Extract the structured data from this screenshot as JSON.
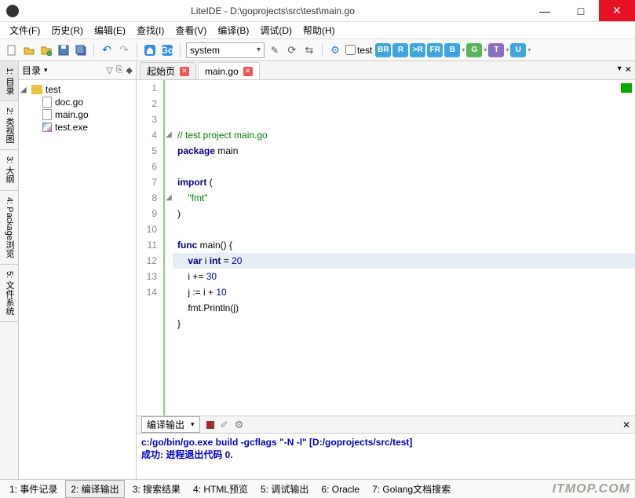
{
  "window": {
    "title": "LiteIDE - D:\\goprojects\\src\\test\\main.go",
    "minimize": "—",
    "maximize": "□",
    "close": "✕"
  },
  "menu": {
    "file": "文件(F)",
    "history": "历史(R)",
    "edit": "编辑(E)",
    "find": "查找(I)",
    "view": "查看(V)",
    "build": "编译(B)",
    "debug": "调试(D)",
    "help": "帮助(H)"
  },
  "toolbar": {
    "env": "system",
    "test_label": "test",
    "badges": [
      "BR",
      "R",
      ">R",
      "FR",
      "B",
      "G",
      "T",
      "U"
    ],
    "badge_colors": [
      "#3da5e0",
      "#3da5e0",
      "#3da5e0",
      "#3da5e0",
      "#3da5e0",
      "#57b557",
      "#8a70c0",
      "#3da5e0"
    ]
  },
  "leftrail": [
    "1: 目录",
    "2: 类视图",
    "3: 大纲",
    "4: Package浏览",
    "5: 文件系统"
  ],
  "sidebar": {
    "title": "目录",
    "root": "test",
    "files": [
      {
        "name": "doc.go",
        "icon": "file"
      },
      {
        "name": "main.go",
        "icon": "file"
      },
      {
        "name": "test.exe",
        "icon": "exe"
      }
    ]
  },
  "tabs": {
    "start": "起始页",
    "file": "main.go"
  },
  "code": {
    "lines": [
      {
        "n": 1,
        "fold": "",
        "html": "<span class='cm'>// test project main.go</span>"
      },
      {
        "n": 2,
        "fold": "",
        "html": "<span class='kw'>package</span> main"
      },
      {
        "n": 3,
        "fold": "",
        "html": ""
      },
      {
        "n": 4,
        "fold": "◢",
        "html": "<span class='kw'>import</span> ("
      },
      {
        "n": 5,
        "fold": "",
        "html": "    <span class='str'>\"fmt\"</span>"
      },
      {
        "n": 6,
        "fold": "",
        "html": ")"
      },
      {
        "n": 7,
        "fold": "",
        "html": ""
      },
      {
        "n": 8,
        "fold": "◢",
        "html": "<span class='kw'>func</span> main() {"
      },
      {
        "n": 9,
        "fold": "",
        "hl": true,
        "html": "    <span class='kw'>var</span> i <span class='kw'>int</span> = <span class='num'>20</span>"
      },
      {
        "n": 10,
        "fold": "",
        "html": "    i += <span class='num'>30</span>"
      },
      {
        "n": 11,
        "fold": "",
        "html": "    j := i + <span class='num'>10</span>"
      },
      {
        "n": 12,
        "fold": "",
        "html": "    fmt.Println(j)"
      },
      {
        "n": 13,
        "fold": "",
        "html": "}"
      },
      {
        "n": 14,
        "fold": "",
        "html": ""
      }
    ]
  },
  "output": {
    "title": "编译输出",
    "line1": "c:/go/bin/go.exe build -gcflags \"-N -l\" [D:/goprojects/src/test]",
    "line2": "成功: 进程退出代码 0."
  },
  "bottom": [
    "1: 事件记录",
    "2: 编译输出",
    "3: 搜索结果",
    "4: HTML预览",
    "5: 调试输出",
    "6: Oracle",
    "7: Golang文档搜索"
  ],
  "watermark": "ITMOP.COM"
}
